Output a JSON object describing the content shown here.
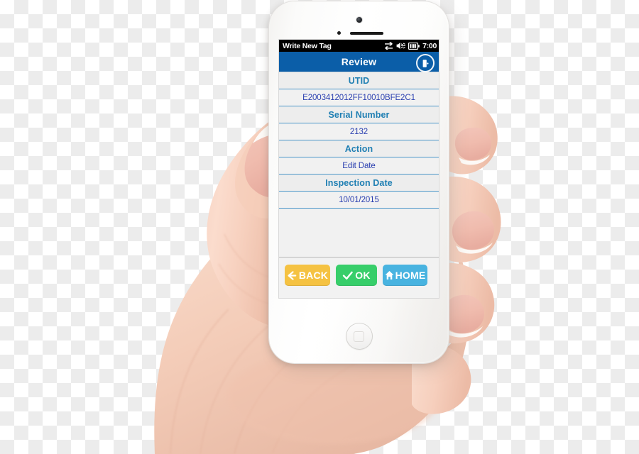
{
  "device": {
    "type": "white-smartphone",
    "held_by": "right-hand",
    "background": "transparency-checkerboard"
  },
  "status_bar": {
    "title": "Write New Tag",
    "icons": [
      "data-transfer-icon",
      "volume-mute-icon",
      "battery-icon"
    ],
    "clock": "7:00",
    "background_color": "#000000",
    "text_color": "#ffffff"
  },
  "title_bar": {
    "title": "Review",
    "action_icon": "exit-door-icon",
    "background_color": "#0b5ea8",
    "text_color": "#ffffff"
  },
  "table": {
    "header_color": "#1f7fb3",
    "value_color": "#2a3fb0",
    "divider_color": "#4b96c8",
    "rows": [
      {
        "label": "UTID",
        "value": "E2003412012FF10010BFE2C1"
      },
      {
        "label": "Serial Number",
        "value": "2132"
      },
      {
        "label": "Action",
        "value": "Edit Date"
      },
      {
        "label": "Inspection Date",
        "value": "10/01/2015"
      }
    ]
  },
  "buttons": [
    {
      "label": "BACK",
      "icon": "arrow-left-icon",
      "color": "#f5c242"
    },
    {
      "label": "OK",
      "icon": "check-icon",
      "color": "#37ce6a"
    },
    {
      "label": "HOME",
      "icon": "home-icon",
      "color": "#48b3e0"
    }
  ],
  "hardware": {
    "home_button": "home-button",
    "front_camera": "front-camera",
    "earpiece": "earpiece-speaker",
    "proximity_sensor": "proximity-sensor"
  }
}
